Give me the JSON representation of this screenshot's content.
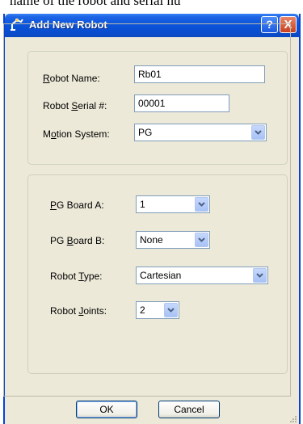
{
  "caption_fragment": "name of the robot and serial nu",
  "dialog": {
    "title": "Add New Robot",
    "help_label": "?",
    "close_label": "X"
  },
  "fields": {
    "robot_name": {
      "pre": "",
      "key": "R",
      "post": "obot Name:",
      "value": "Rb01"
    },
    "robot_serial": {
      "pre": "Robot ",
      "key": "S",
      "post": "erial #:",
      "value": "00001"
    },
    "motion_system": {
      "pre": "M",
      "key": "o",
      "post": "tion System:",
      "value": "PG"
    },
    "pg_board_a": {
      "pre": "",
      "key": "P",
      "post": "G Board A:",
      "value": "1"
    },
    "pg_board_b": {
      "pre": "PG ",
      "key": "B",
      "post": "oard B:",
      "value": "None"
    },
    "robot_type": {
      "pre": "Robot ",
      "key": "T",
      "post": "ype:",
      "value": "Cartesian"
    },
    "robot_joints": {
      "pre": "Robot ",
      "key": "J",
      "post": "oints:",
      "value": "2"
    }
  },
  "buttons": {
    "ok": "OK",
    "cancel": "Cancel"
  },
  "icons": {
    "title": "robot-arm-icon",
    "dropdown": "chevron-down-icon",
    "resize": "resize-grip-icon"
  },
  "colors": {
    "titlebar": "#0b55db",
    "dialog_bg": "#ece9d8",
    "field_border": "#7f9db9",
    "close_button": "#c8401f"
  }
}
